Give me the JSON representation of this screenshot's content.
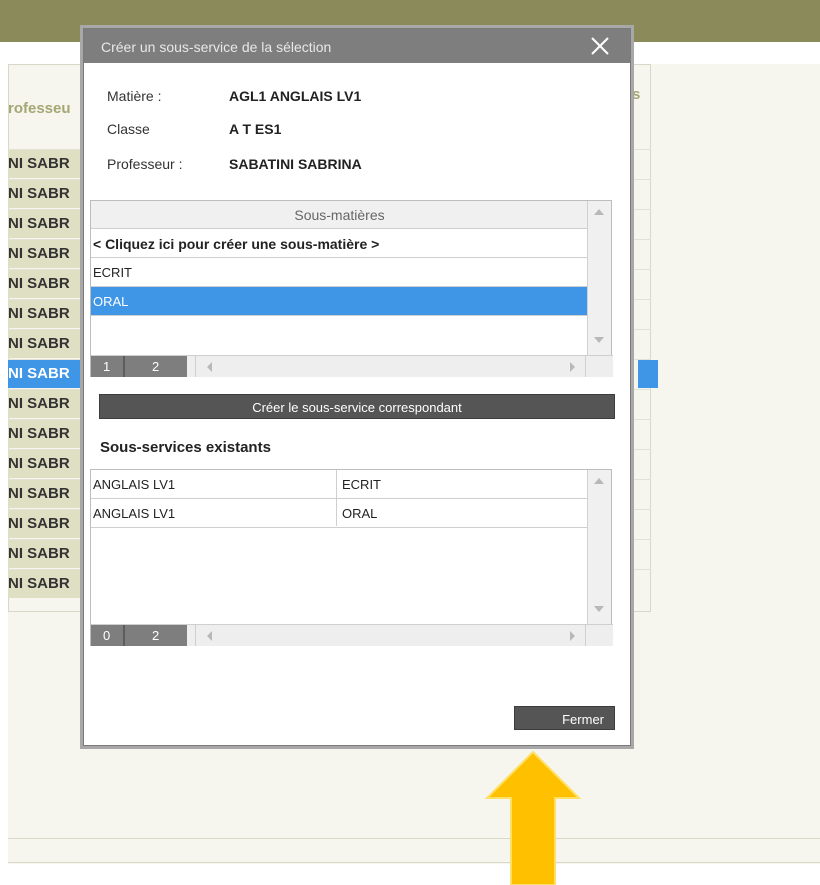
{
  "background": {
    "column_header_left": "rofesseu",
    "column_header_right": "s",
    "rows": [
      {
        "text": "NI SABR"
      },
      {
        "text": "NI SABR"
      },
      {
        "text": "NI SABR"
      },
      {
        "text": "NI SABR"
      },
      {
        "text": "NI SABR"
      },
      {
        "text": "NI SABR"
      },
      {
        "text": "NI SABR"
      },
      {
        "text": "NI SABR"
      },
      {
        "text": "NI SABR"
      },
      {
        "text": "NI SABR"
      },
      {
        "text": "NI SABR"
      },
      {
        "text": "NI SABR"
      },
      {
        "text": "NI SABR"
      },
      {
        "text": "NI SABR"
      },
      {
        "text": "NI SABR"
      }
    ],
    "selected_row_index": 7
  },
  "dialog": {
    "title": "Créer un sous-service de la sélection",
    "matiere_label": "Matière :",
    "matiere_value": "AGL1 ANGLAIS LV1",
    "classe_label": "Classe",
    "classe_value": "A T ES1",
    "professeur_label": "Professeur :",
    "professeur_value": "SABATINI SABRINA",
    "sous_matieres": {
      "header": "Sous-matières",
      "create_row": "< Cliquez ici pour créer une sous-matière >",
      "rows": [
        "ECRIT",
        "ORAL"
      ],
      "selected": "ORAL",
      "pager_a": "1",
      "pager_b": "2"
    },
    "create_button": "Créer le sous-service correspondant",
    "existing_title": "Sous-services existants",
    "existing": {
      "rows": [
        {
          "service": "ANGLAIS LV1",
          "sous_matiere": "ECRIT"
        },
        {
          "service": "ANGLAIS LV1",
          "sous_matiere": "ORAL"
        }
      ],
      "pager_a": "0",
      "pager_b": "2"
    },
    "close_button": "Fermer"
  },
  "colors": {
    "topbar": "#8a8a5a",
    "selection": "#3f95e6",
    "dialog_title": "#7e7e7e",
    "button": "#555555",
    "annotation_arrow": "#ffc000"
  },
  "icons": {
    "close": "close-icon",
    "annotation": "annotation-arrow-up-icon"
  }
}
